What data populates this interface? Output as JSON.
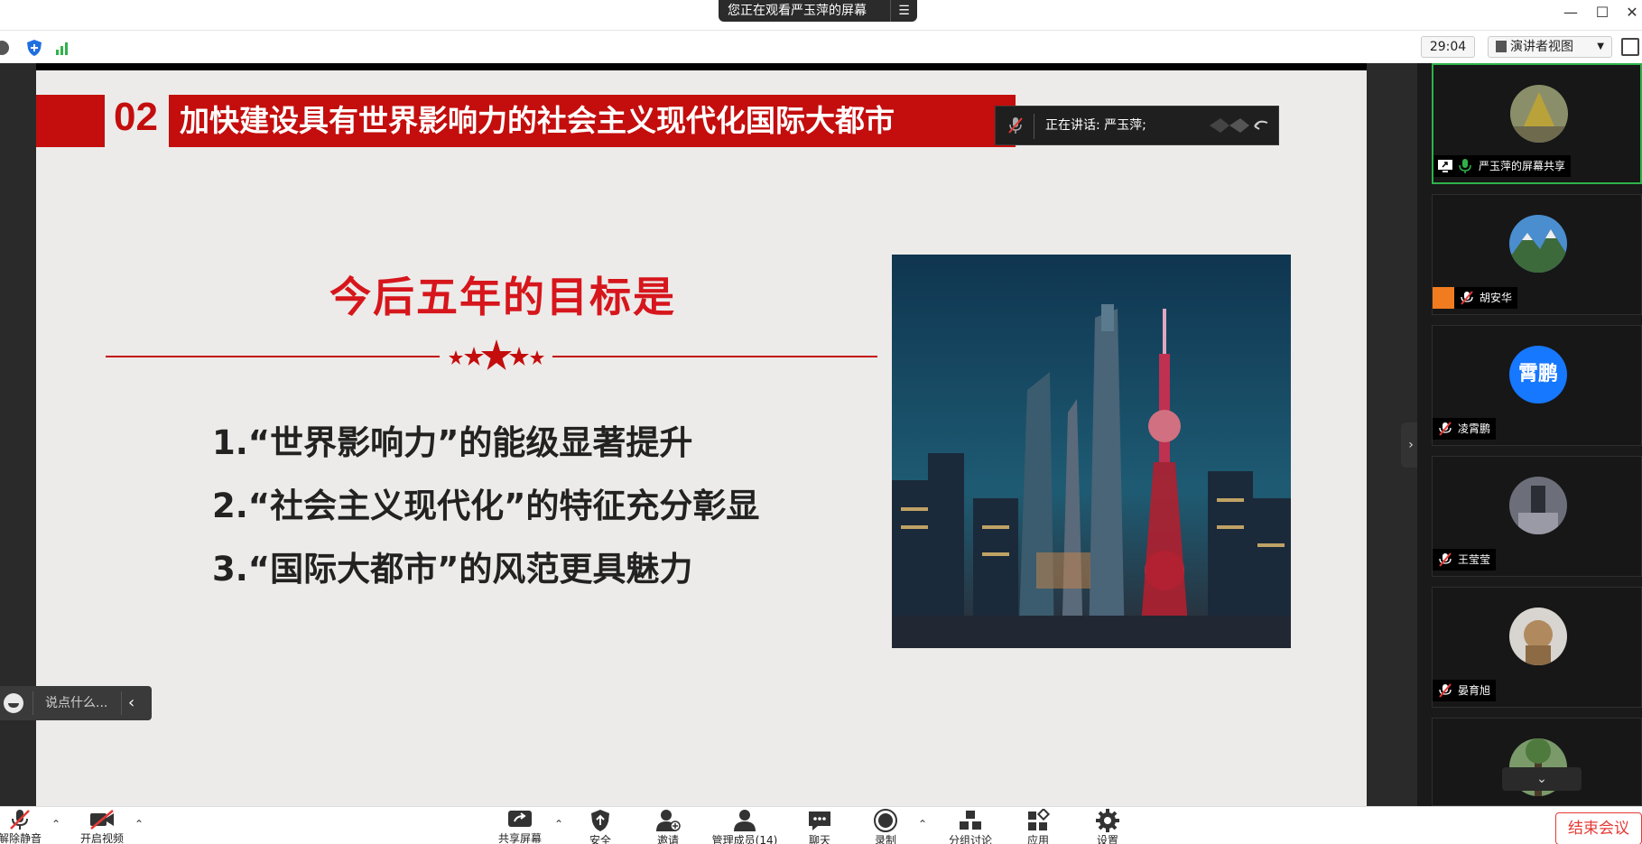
{
  "window": {
    "share_banner": "您正在观看严玉萍的屏幕",
    "controls": [
      "minimize-icon",
      "maximize-icon",
      "close-icon"
    ]
  },
  "topbar": {
    "timer": "29:04",
    "view_label": "演讲者视图",
    "icons": [
      "info-icon",
      "shield-icon",
      "signal-icon",
      "fullscreen-icon"
    ]
  },
  "slide": {
    "number": "02",
    "title": "加快建设具有世界影响力的社会主义现代化国际大都市",
    "goal_title": "今后五年的目标是",
    "goals": [
      "1.“世界影响力”的能级显著提升",
      "2.“社会主义现代化”的特征充分彰显",
      "3.“国际大都市”的风范更具魅力"
    ],
    "accent_color": "#c40d0d"
  },
  "speaking": {
    "text": "正在讲话: 严玉萍;"
  },
  "chat": {
    "placeholder": "说点什么..."
  },
  "participants": [
    {
      "name": "严玉萍的屏幕共享",
      "type": "screen-share"
    },
    {
      "name": "胡安华",
      "type": "host"
    },
    {
      "name": "凌霄鹏",
      "avatar_text": "霄鹏"
    },
    {
      "name": "王莹莹"
    },
    {
      "name": "晏育旭"
    },
    {
      "name": ""
    }
  ],
  "bottom_bar": {
    "items": [
      {
        "label": "解除静音",
        "icon": "mic-muted-icon"
      },
      {
        "label": "开启视频",
        "icon": "video-off-icon"
      },
      {
        "label": "共享屏幕",
        "icon": "share-screen-icon"
      },
      {
        "label": "安全",
        "icon": "security-icon"
      },
      {
        "label": "邀请",
        "icon": "invite-icon"
      },
      {
        "label": "管理成员(14)",
        "icon": "members-icon"
      },
      {
        "label": "聊天",
        "icon": "chat-icon"
      },
      {
        "label": "录制",
        "icon": "record-icon"
      },
      {
        "label": "分组讨论",
        "icon": "breakout-icon"
      },
      {
        "label": "应用",
        "icon": "apps-icon"
      },
      {
        "label": "设置",
        "icon": "settings-icon"
      }
    ],
    "end_label": "结束会议"
  }
}
